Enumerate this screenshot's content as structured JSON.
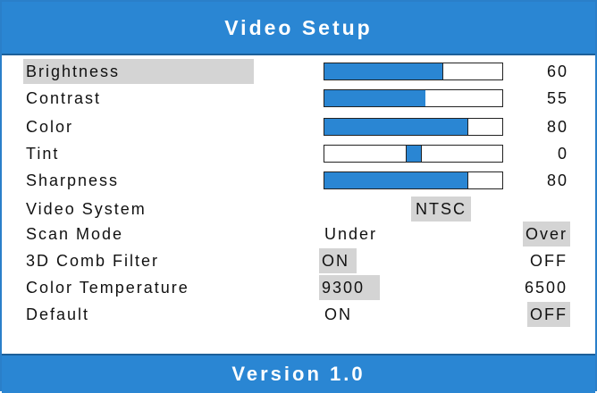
{
  "header": {
    "title": "Video Setup"
  },
  "footer": {
    "version": "Version 1.0"
  },
  "settings": {
    "brightness": {
      "label": "Brightness",
      "value": "60",
      "level": 0.67
    },
    "contrast": {
      "label": "Contrast",
      "value": "55",
      "level": 0.57
    },
    "color": {
      "label": "Color",
      "value": "80",
      "level": 0.81
    },
    "tint": {
      "label": "Tint",
      "value": "0",
      "level": 0.5
    },
    "sharpness": {
      "label": "Sharpness",
      "value": "80",
      "level": 0.81
    },
    "video_system": {
      "label": "Video System",
      "option": "NTSC"
    },
    "scan_mode": {
      "label": "Scan Mode",
      "option_a": "Under",
      "option_b": "Over",
      "selected": "Over"
    },
    "comb_filter": {
      "label": "3D Comb Filter",
      "option_a": "ON",
      "option_b": "OFF",
      "selected": "ON"
    },
    "color_temperature": {
      "label": "Color Temperature",
      "option_a": "9300",
      "option_b": "6500",
      "selected": "9300"
    },
    "default": {
      "label": "Default",
      "option_a": "ON",
      "option_b": "OFF",
      "selected": "OFF"
    }
  },
  "colors": {
    "accent": "#2a86d3",
    "highlight": "#d4d4d4",
    "text": "#111111"
  }
}
